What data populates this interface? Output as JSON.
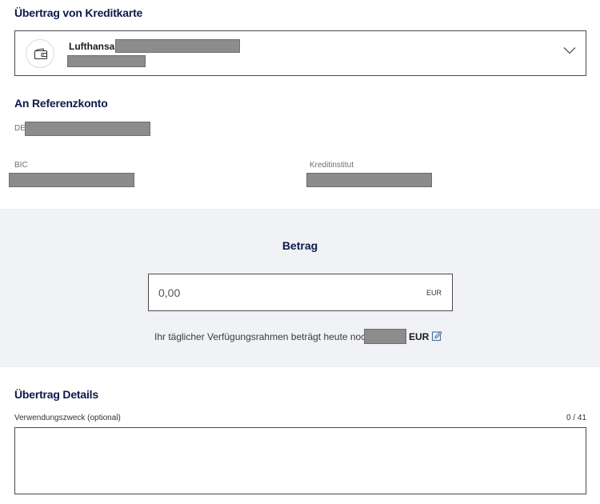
{
  "transfer_from": {
    "title": "Übertrag von Kreditkarte",
    "card_name": "Lufthansa"
  },
  "reference_account": {
    "title": "An Referenzkonto",
    "iban_prefix": "DE",
    "bic_label": "BIC",
    "bank_label": "Kreditinstitut"
  },
  "amount": {
    "title": "Betrag",
    "value": "0,00",
    "currency": "EUR",
    "limit_text": "Ihr täglicher Verfügungsrahmen beträgt heute noch:",
    "limit_currency": "EUR"
  },
  "details": {
    "title": "Übertrag Details",
    "purpose_label": "Verwendungszweck (optional)",
    "char_count": "0 / 41",
    "purpose_value": ""
  },
  "colors": {
    "heading": "#0b1a4a",
    "band": "#f0f2f5",
    "accent_icon": "#4a6fa5"
  },
  "icons": {
    "wallet": "wallet-icon",
    "chevron": "chevron-down-icon",
    "edit": "edit-icon"
  }
}
